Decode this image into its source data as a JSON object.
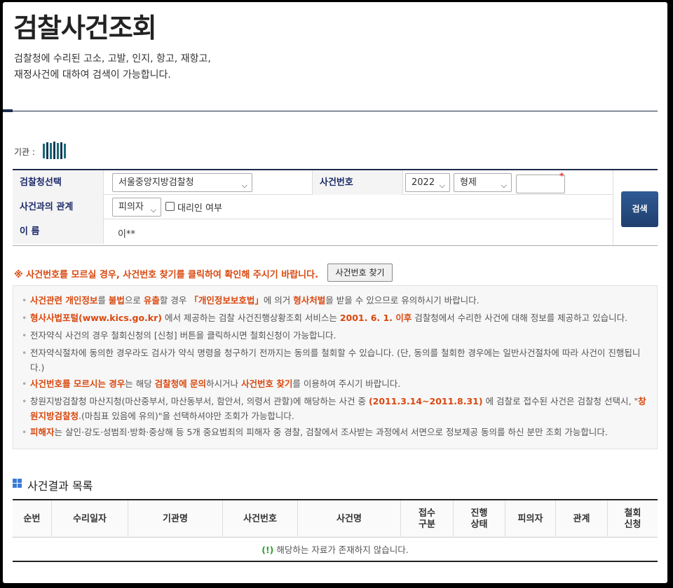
{
  "page": {
    "title": "검찰사건조회",
    "desc_line1": "검찰청에 수리된 고소, 고발, 인지, 항고, 재항고,",
    "desc_line2": "재정사건에 대하여 검색이 가능합니다."
  },
  "org": {
    "label": "기관 :"
  },
  "search": {
    "office_label": "검찰청선택",
    "office_value": "서울중앙지방검찰청",
    "relation_label": "사건과의 관계",
    "relation_value": "피의자",
    "proxy_label": "대리인 여부",
    "name_label": "이 름",
    "name_value": "이**",
    "case_no_label": "사건번호",
    "year_value": "2022",
    "type_value": "형제",
    "case_no_value": "",
    "required_mark": "*",
    "search_button": "검색"
  },
  "notice": {
    "text": "※ 사건번호를 모르실 경우, 사건번호 찾기를 클릭하여 확인해 주시기 바랍니다.",
    "find_button": "사건번호 찾기"
  },
  "info": {
    "i1_a": "사건관련 개인정보",
    "i1_b": "를 ",
    "i1_c": "불법",
    "i1_d": "으로 ",
    "i1_e": "유출",
    "i1_f": "할 경우 ",
    "i1_g": "「개인정보보호법」",
    "i1_h": "에 의거 ",
    "i1_i": "형사처벌",
    "i1_j": "을 받을 수 있으므로 유의하시기 바랍니다.",
    "i2_a": "형사사법포털(www.kics.go.kr)",
    "i2_b": " 에서 제공하는 검찰 사건진행상황조회 서비스는 ",
    "i2_c": "2001. 6. 1. 이후",
    "i2_d": " 검찰청에서 수리한 사건에 대해 정보를 제공하고 있습니다.",
    "i3": "전자약식 사건의 경우 철회신청의 [신청] 버튼을 클릭하시면 철회신청이 가능합니다.",
    "i4": "전자약식절차에 동의한 경우라도 검사가 약식 명령을 청구하기 전까지는 동의를 철회할 수 있습니다. (단, 동의를 철회한 경우에는 일반사건절차에 따라 사건이 진행됩니다.)",
    "i5_a": "사건번호를 모르시는 경우",
    "i5_b": "는 해당 ",
    "i5_c": "검찰청에 문의",
    "i5_d": "하시거나 ",
    "i5_e": "사건번호 찾기",
    "i5_f": "를 이용하여 주시기 바랍니다.",
    "i6_a": "창원지방검찰청 마산지청(마산중부서, 마산동부서, 함안서, 의령서 관할)에 해당하는 사건 중 ",
    "i6_b": "(2011.3.14~2011.8.31)",
    "i6_c": " 에 검찰로 접수된 사건은 검찰청 선택시, \"",
    "i6_d": "창원지방검찰청",
    "i6_e": ".(마침표 있음에 유의)\"을 선택하셔야만 조회가 가능합니다.",
    "i7_a": "피해자",
    "i7_b": "는 살인·강도·성범죄·방화·중상해 등 5개 중요범죄의 피해자 중 경찰, 검찰에서 조사받는 과정에서 서면으로 정보제공 동의를 하신 분만 조회 가능합니다."
  },
  "results": {
    "title": "사건결과 목록",
    "headers": [
      "순번",
      "수리일자",
      "기관명",
      "사건번호",
      "사건명",
      "접수\n구분",
      "진행\n상태",
      "피의자",
      "관계",
      "철회\n신청"
    ],
    "empty_mark": "(!)",
    "empty_text": " 해당하는 자료가 존재하지 않습니다."
  },
  "colors": {
    "navy": "#1c2b4a",
    "accent": "#d9480f",
    "button": "#24467a"
  }
}
